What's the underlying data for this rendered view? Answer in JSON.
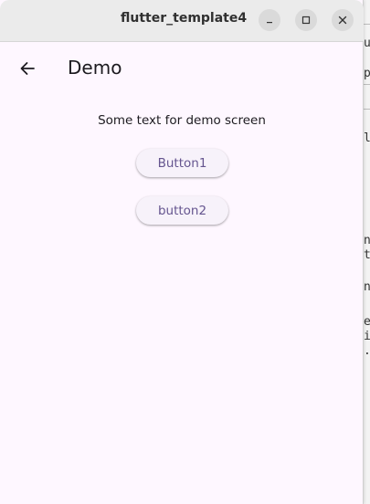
{
  "window": {
    "title": "flutter_template4",
    "controls": [
      "minimize-icon",
      "maximize-icon",
      "close-icon"
    ]
  },
  "appbar": {
    "back_icon": "arrow-back-icon",
    "title": "Demo"
  },
  "body": {
    "text": "Some text for demo screen",
    "buttons": [
      {
        "label": "Button1"
      },
      {
        "label": "button2"
      }
    ]
  },
  "background_window": {
    "fragments": [
      "u",
      "p",
      "l",
      "n",
      "t",
      "n",
      "e",
      "i",
      "."
    ]
  },
  "colors": {
    "titlebar": "#ebebeb",
    "surface": "#fef7ff",
    "button_bg": "#f7f2fa",
    "button_text": "#65558f",
    "text": "#1d1b20"
  }
}
